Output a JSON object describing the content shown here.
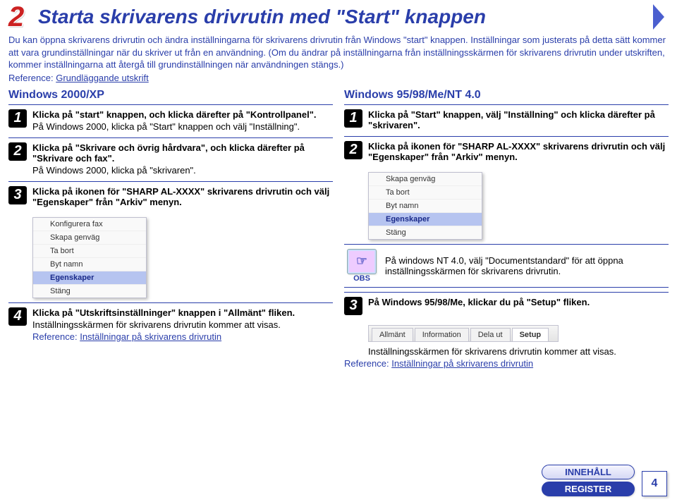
{
  "header": {
    "section_number": "2",
    "title": "Starta skrivarens drivrutin med \"Start\" knappen",
    "intro": "Du kan öppna skrivarens drivrutin och ändra inställningarna för skrivarens drivrutin från Windows \"start\" knappen. Inställningar som justerats på detta sätt kommer att vara grundinställningar när du skriver ut från en användning. (Om du ändrar på inställningarna från inställningsskärmen för skrivarens drivrutin under utskriften, kommer inställningarna att återgå till grundinställningen när användningen stängs.)",
    "reference_label": "Reference:",
    "reference_link": "Grundläggande utskrift"
  },
  "left": {
    "heading": "Windows 2000/XP",
    "steps": [
      {
        "num": "1",
        "bold": "Klicka på \"start\" knappen, och klicka därefter på \"Kontrollpanel\".",
        "sub": "På Windows 2000, klicka på \"Start\" knappen och välj \"Inställning\"."
      },
      {
        "num": "2",
        "bold": "Klicka på \"Skrivare och övrig hårdvara\", och klicka därefter på \"Skrivare och fax\".",
        "sub": "På Windows 2000, klicka på \"skrivaren\"."
      },
      {
        "num": "3",
        "bold": "Klicka på ikonen för \"SHARP AL-XXXX\" skrivarens drivrutin och välj \"Egenskaper\" från \"Arkiv\" menyn."
      },
      {
        "num": "4",
        "bold": "Klicka på \"Utskriftsinställninger\" knappen i \"Allmänt\" fliken.",
        "sub": "Inställningsskärmen för skrivarens drivrutin kommer att visas.",
        "ref_label": "Reference:",
        "ref_link": "Inställningar på skrivarens drivrutin"
      }
    ],
    "menu": {
      "items": [
        "Konfigurera fax",
        "Skapa genväg",
        "Ta bort",
        "Byt namn",
        "Egenskaper",
        "Stäng"
      ],
      "selected": "Egenskaper"
    }
  },
  "right": {
    "heading": "Windows 95/98/Me/NT 4.0",
    "steps": [
      {
        "num": "1",
        "bold": "Klicka på \"Start\" knappen, välj \"Inställning\" och klicka därefter på \"skrivaren\"."
      },
      {
        "num": "2",
        "bold": "Klicka på ikonen för \"SHARP AL-XXXX\" skrivarens drivrutin och välj \"Egenskaper\" från \"Arkiv\" menyn."
      },
      {
        "num": "3",
        "bold": "På Windows 95/98/Me, klickar du på \"Setup\" fliken.",
        "sub": "Inställningsskärmen för skrivarens drivrutin kommer att visas.",
        "ref_label": "Reference:",
        "ref_link": "Inställningar på skrivarens drivrutin"
      }
    ],
    "menu": {
      "items": [
        "Skapa genväg",
        "Ta bort",
        "Byt namn",
        "Egenskaper",
        "Stäng"
      ],
      "selected": "Egenskaper"
    },
    "obs": {
      "label": "OBS",
      "glyph": "☞",
      "text": "På windows NT 4.0, välj \"Documentstandard\" för att öppna inställningsskärmen för skrivarens drivrutin."
    },
    "tabs": {
      "items": [
        "Allmänt",
        "Information",
        "Dela ut",
        "Setup"
      ],
      "selected": "Setup"
    }
  },
  "nav": {
    "contents": "INNEHÅLL",
    "register": "REGISTER",
    "page": "4"
  }
}
